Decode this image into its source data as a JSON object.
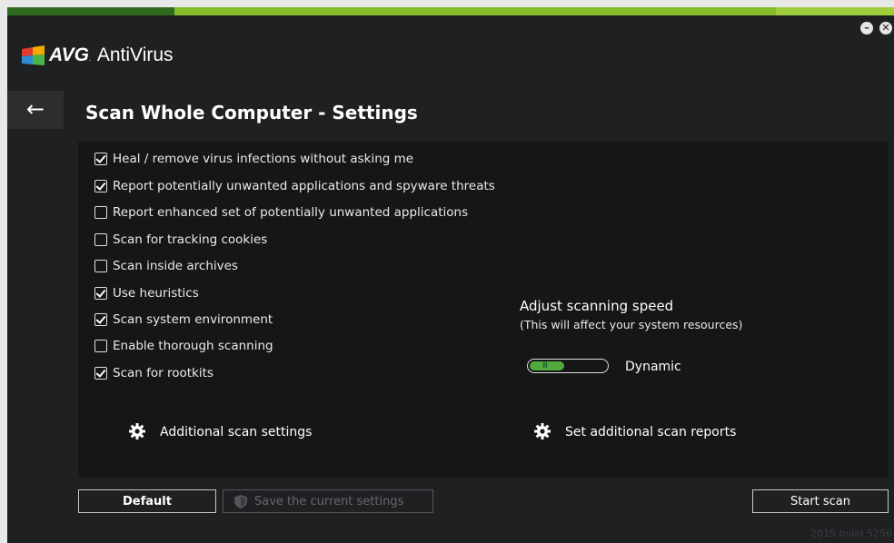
{
  "app": {
    "brand_bold": "AVG",
    "brand_rest": "AntiVirus"
  },
  "window_controls": {
    "minimize": "–",
    "close": "✕"
  },
  "nav": {
    "back_icon": "←"
  },
  "page": {
    "title": "Scan Whole Computer - Settings"
  },
  "options": [
    {
      "label": "Heal / remove virus infections without asking me",
      "checked": true
    },
    {
      "label": "Report potentially unwanted applications and spyware threats",
      "checked": true
    },
    {
      "label": "Report enhanced set of potentially unwanted applications",
      "checked": false
    },
    {
      "label": "Scan for tracking cookies",
      "checked": false
    },
    {
      "label": "Scan inside archives",
      "checked": false
    },
    {
      "label": "Use heuristics",
      "checked": true
    },
    {
      "label": "Scan system environment",
      "checked": true
    },
    {
      "label": "Enable thorough scanning",
      "checked": false
    },
    {
      "label": "Scan for rootkits",
      "checked": true
    }
  ],
  "speed": {
    "title": "Adjust scanning speed",
    "subtitle": "(This will affect your system resources)",
    "value_label": "Dynamic",
    "level": 0.45,
    "grip": "III"
  },
  "links": {
    "additional_settings": "Additional scan settings",
    "additional_reports": "Set additional scan reports"
  },
  "buttons": {
    "default": "Default",
    "save": "Save the current settings",
    "start": "Start scan"
  },
  "footer": {
    "build": "2015 build 5256"
  },
  "colors": {
    "accent_green": "#84bb27",
    "window_bg": "#1f2022",
    "panel_bg": "#151618"
  }
}
